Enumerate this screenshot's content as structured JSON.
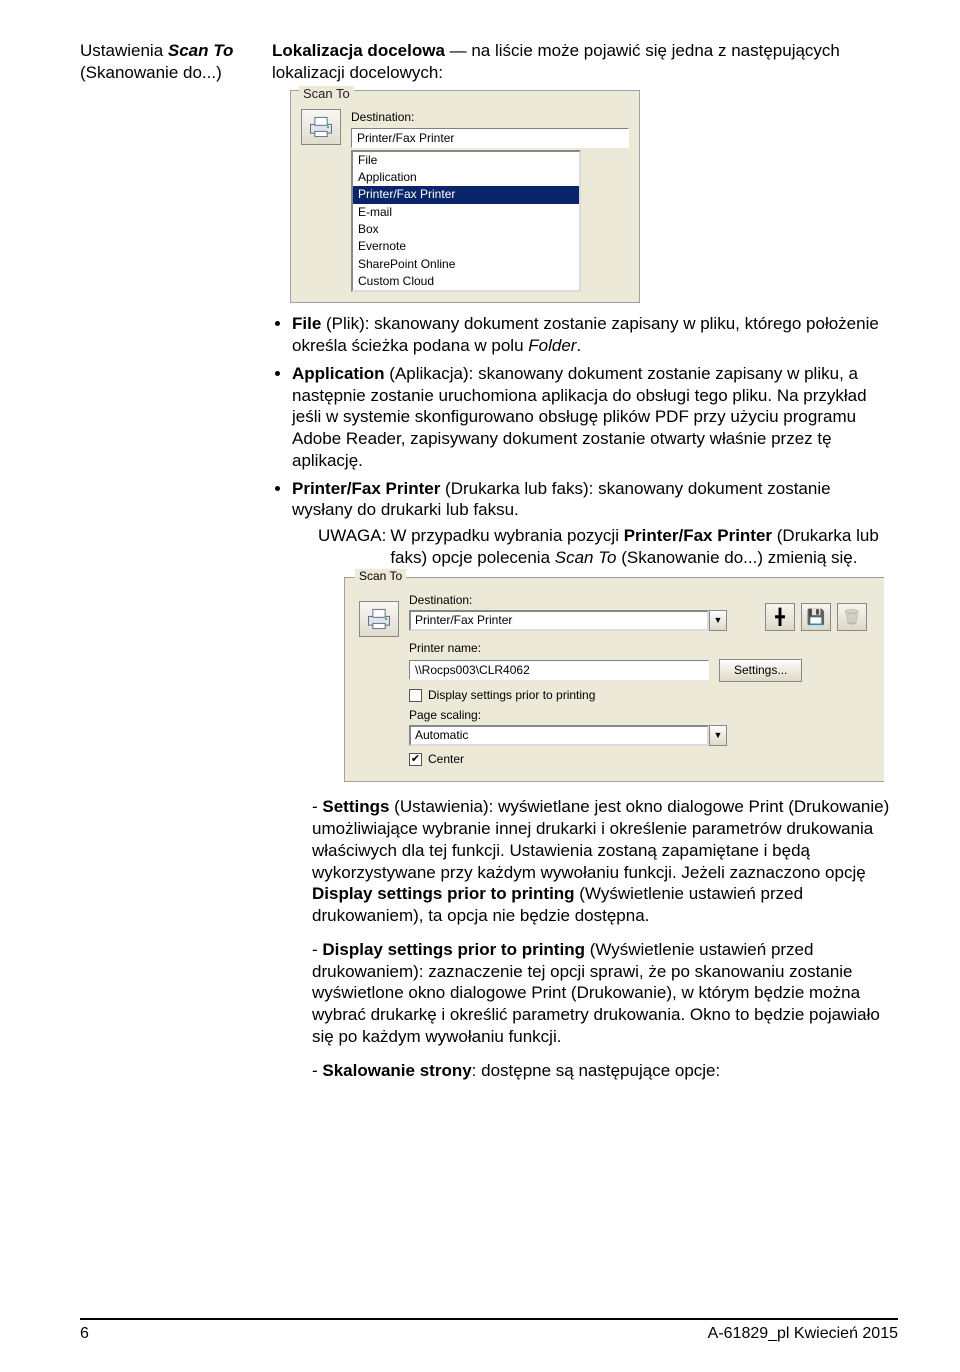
{
  "left_heading_line1": "Ustawienia ",
  "left_heading_italic": "Scan To",
  "left_heading_line2": "(Skanowanie do...)",
  "intro_bold": "Lokalizacja docelowa",
  "intro_rest": " — na liście może pojawić się jedna z następujących lokalizacji docelowych:",
  "scan_to_panel": {
    "legend": "Scan To",
    "destination_label": "Destination:",
    "destination_value": "Printer/Fax Printer",
    "options": [
      "File",
      "Application",
      "Printer/Fax Printer",
      "E-mail",
      "Box",
      "Evernote",
      "SharePoint Online",
      "Custom Cloud"
    ],
    "selected_index": 2
  },
  "bullets": {
    "b1_bold": "File",
    "b1_rest": " (Plik): skanowany dokument zostanie zapisany w pliku, którego położenie określa ścieżka podana w polu ",
    "b1_italic": "Folder",
    "b1_end": ".",
    "b2_bold": "Application",
    "b2_rest": " (Aplikacja): skanowany dokument zostanie zapisany w pliku, a następnie zostanie uruchomiona aplikacja do obsługi tego pliku. Na przykład jeśli w systemie skonfigurowano obsługę plików PDF przy użyciu programu Adobe Reader, zapisywany dokument zostanie otwarty właśnie przez tę aplikację.",
    "b3_bold": "Printer/Fax Printer",
    "b3_rest": " (Drukarka lub faks): skanowany dokument zostanie wysłany do drukarki lub faksu.",
    "uwaga_label": "UWAGA:",
    "uwaga_body_a": "W przypadku wybrania pozycji ",
    "uwaga_body_bold": "Printer/Fax Printer",
    "uwaga_body_b": " (Drukarka lub faks) opcje polecenia ",
    "uwaga_body_italic": "Scan To",
    "uwaga_body_c": " (Skanowanie do...) zmienią się."
  },
  "scan_to_panel2": {
    "legend": "Scan To",
    "destination_label": "Destination:",
    "destination_value": "Printer/Fax Printer",
    "printer_name_label": "Printer name:",
    "printer_name_value": "\\\\Rocps003\\CLR4062",
    "settings_btn": "Settings...",
    "display_prior_label": "Display settings prior to printing",
    "page_scaling_label": "Page scaling:",
    "page_scaling_value": "Automatic",
    "center_label": "Center"
  },
  "sub": {
    "s1_bold": "Settings",
    "s1_rest": " (Ustawienia): wyświetlane jest okno dialogowe Print (Drukowanie) umożliwiające wybranie innej drukarki i określenie parametrów drukowania właściwych dla tej funkcji. Ustawienia zostaną zapamiętane i będą wykorzystywane przy każdym wywołaniu funkcji. Jeżeli zaznaczono opcję ",
    "s1_bold2": "Display settings prior to printing",
    "s1_rest2": " (Wyświetlenie ustawień przed drukowaniem), ta opcja nie będzie dostępna.",
    "s2_bold": "Display settings prior to printing",
    "s2_rest": " (Wyświetlenie ustawień przed drukowaniem): zaznaczenie tej opcji sprawi, że po skanowaniu zostanie wyświetlone okno dialogowe Print (Drukowanie), w którym będzie można wybrać drukarkę i określić parametry drukowania. Okno to będzie pojawiało się po każdym wywołaniu funkcji.",
    "s3_bold": "Skalowanie strony",
    "s3_rest": ": dostępne są następujące opcje:"
  },
  "footer_left": "6",
  "footer_right": "A-61829_pl  Kwiecień 2015"
}
